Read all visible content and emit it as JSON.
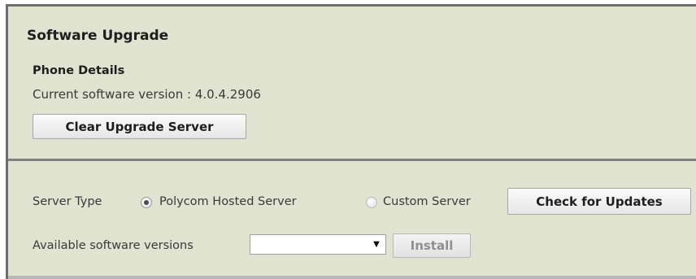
{
  "panel": {
    "title": "Software Upgrade",
    "phone_details": {
      "heading": "Phone Details",
      "current_version_label": "Current software version : 4.0.4.2906",
      "clear_button": "Clear Upgrade Server"
    },
    "server": {
      "server_type_label": "Server Type",
      "options": [
        {
          "label": "Polycom Hosted Server",
          "selected": true
        },
        {
          "label": "Custom Server",
          "selected": false
        }
      ],
      "check_button": "Check for Updates",
      "available_label": "Available software versions",
      "available_value": "",
      "install_button": "Install",
      "install_enabled": false
    }
  },
  "icons": {
    "dropdown": "chevron-down-icon"
  },
  "colors": {
    "panel_background": "#dfe3cf",
    "border": "#6d6d6d"
  }
}
